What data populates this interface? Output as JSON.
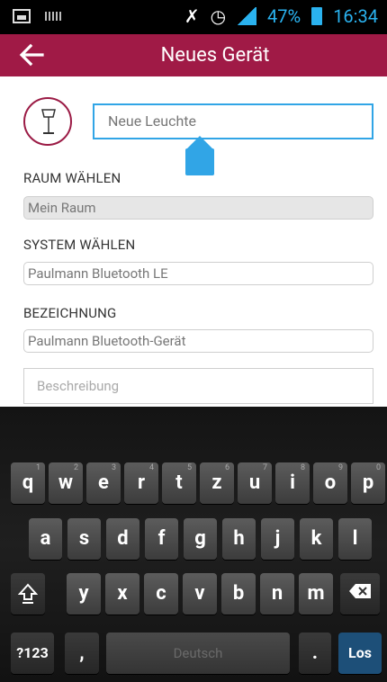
{
  "status_bar": {
    "battery": "47%",
    "time": "16:34"
  },
  "app_bar": {
    "title": "Neues Gerät"
  },
  "form": {
    "name_value": "Neue Leuchte",
    "room_label": "RAUM WÄHLEN",
    "room_value": "Mein Raum",
    "system_label": "SYSTEM WÄHLEN",
    "system_value": "Paulmann Bluetooth LE",
    "designation_label": "BEZEICHNUNG",
    "designation_value": "Paulmann Bluetooth-Gerät",
    "description_placeholder": "Beschreibung"
  },
  "keyboard": {
    "row1": [
      {
        "k": "q",
        "h": "1"
      },
      {
        "k": "w",
        "h": "2"
      },
      {
        "k": "e",
        "h": "3"
      },
      {
        "k": "r",
        "h": "4"
      },
      {
        "k": "t",
        "h": "5"
      },
      {
        "k": "z",
        "h": "6"
      },
      {
        "k": "u",
        "h": "7"
      },
      {
        "k": "i",
        "h": "8"
      },
      {
        "k": "o",
        "h": "9"
      },
      {
        "k": "p",
        "h": "0"
      }
    ],
    "row2": [
      "a",
      "s",
      "d",
      "f",
      "g",
      "h",
      "j",
      "k",
      "l"
    ],
    "row3": [
      "y",
      "x",
      "c",
      "v",
      "b",
      "n",
      "m"
    ],
    "sym_label": "?123",
    "comma": ",",
    "space_label": "Deutsch",
    "period": ".",
    "enter_label": "Los"
  }
}
